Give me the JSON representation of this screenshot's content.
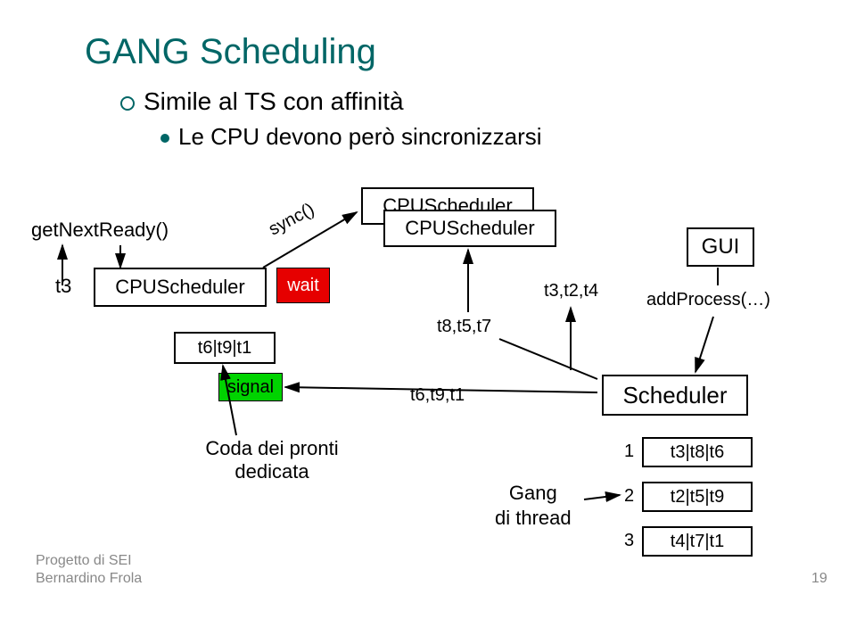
{
  "title": "GANG Scheduling",
  "subtitle": "Simile al TS con affinità",
  "subpoint": "Le CPU devono però sincronizzarsi",
  "getNextReady": "getNextReady()",
  "t3label": "t3",
  "cpuSchedLeft": "CPUScheduler",
  "cpuSchedTop": "CPUScheduler",
  "cpuSchedTop2": "CPUScheduler",
  "sync": "sync()",
  "wait": "wait",
  "queue": "t6|t9|t1",
  "signal": "signal",
  "coda1": "Coda dei pronti",
  "coda2": "dedicata",
  "t8t5t7": "t8,t5,t7",
  "t6t9t1": "t6,t9,t1",
  "t3t2t4": "t3,t2,t4",
  "gui": "GUI",
  "addProcess": "addProcess(…)",
  "scheduler": "Scheduler",
  "gangL1": "Gang",
  "gangL2": "di thread",
  "row1num": "1",
  "row2num": "2",
  "row3num": "3",
  "row1": "t3|t8|t6",
  "row2": "t2|t5|t9",
  "row3": "t4|t7|t1",
  "footer1": "Progetto di SEI",
  "footer2": "Bernardino Frola",
  "page": "19"
}
